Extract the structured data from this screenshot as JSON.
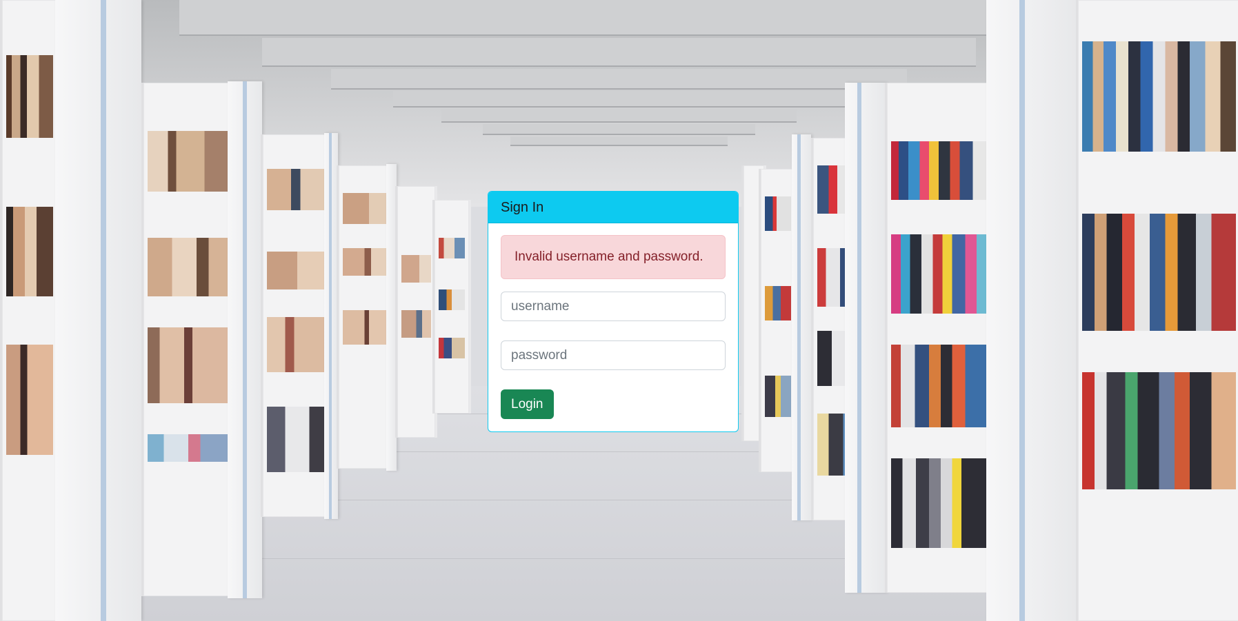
{
  "card": {
    "title": "Sign In",
    "alert_text": "Invalid username and password.",
    "username": {
      "placeholder": "username",
      "value": ""
    },
    "password": {
      "placeholder": "password",
      "value": ""
    },
    "login_label": "Login"
  },
  "colors": {
    "header": "#0dcaf0",
    "alert_bg": "#f8d7da",
    "alert_text": "#842029",
    "login_button": "#198754"
  }
}
